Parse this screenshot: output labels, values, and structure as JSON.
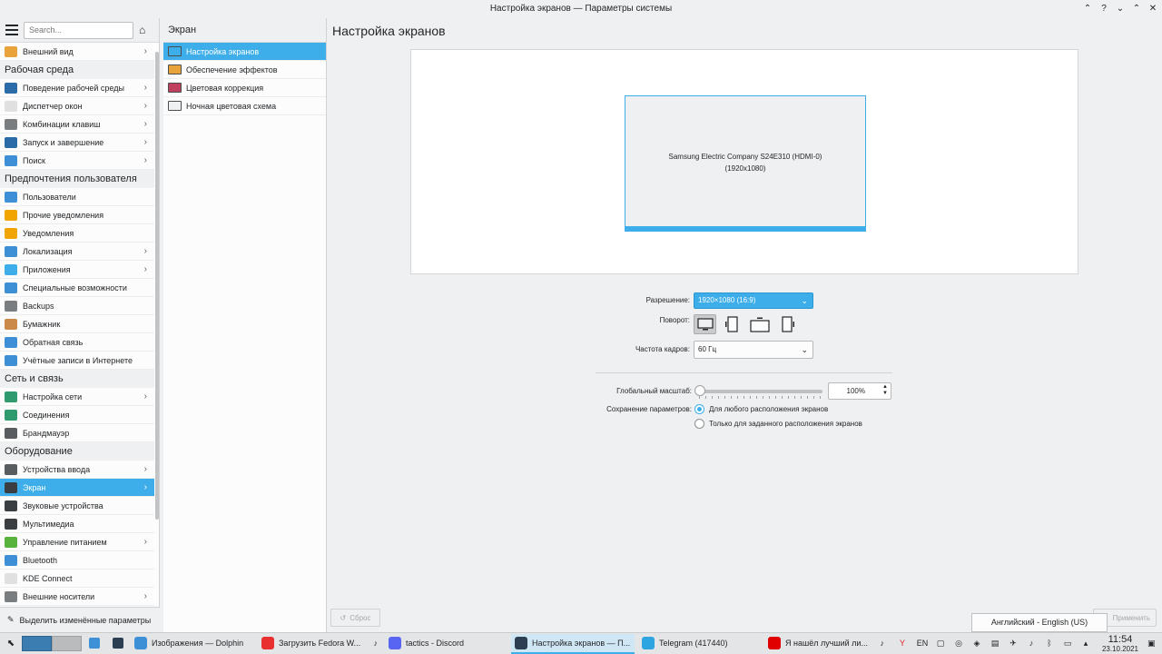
{
  "window": {
    "title": "Настройка экранов — Параметры системы",
    "buttons": [
      "⌃",
      "?",
      "⌄",
      "⌃",
      "✕"
    ]
  },
  "sidebar": {
    "search_placeholder": "Search...",
    "rows": [
      {
        "type": "item",
        "label": "Внешний вид",
        "chevron": true,
        "color": "#e8a33a"
      },
      {
        "type": "cat",
        "label": "Рабочая среда"
      },
      {
        "type": "item",
        "label": "Поведение рабочей среды",
        "chevron": true,
        "color": "#2b6ba8"
      },
      {
        "type": "item",
        "label": "Диспетчер окон",
        "chevron": true,
        "color": "#e0e0e0"
      },
      {
        "type": "item",
        "label": "Комбинации клавиш",
        "chevron": true,
        "color": "#7a7d80"
      },
      {
        "type": "item",
        "label": "Запуск и завершение",
        "chevron": true,
        "color": "#2b6ba8"
      },
      {
        "type": "item",
        "label": "Поиск",
        "chevron": true,
        "color": "#3d8fd6"
      },
      {
        "type": "cat",
        "label": "Предпочтения пользователя"
      },
      {
        "type": "item",
        "label": "Пользователи",
        "chevron": false,
        "color": "#3d8fd6"
      },
      {
        "type": "item",
        "label": "Прочие уведомления",
        "chevron": false,
        "color": "#f0a500"
      },
      {
        "type": "item",
        "label": "Уведомления",
        "chevron": false,
        "color": "#f0a500"
      },
      {
        "type": "item",
        "label": "Локализация",
        "chevron": true,
        "color": "#3d8fd6"
      },
      {
        "type": "item",
        "label": "Приложения",
        "chevron": true,
        "color": "#3daee9"
      },
      {
        "type": "item",
        "label": "Специальные возможности",
        "chevron": false,
        "color": "#3d8fd6"
      },
      {
        "type": "item",
        "label": "Backups",
        "chevron": false,
        "color": "#7a7d80"
      },
      {
        "type": "item",
        "label": "Бумажник",
        "chevron": false,
        "color": "#c98a4a"
      },
      {
        "type": "item",
        "label": "Обратная связь",
        "chevron": false,
        "color": "#3d8fd6"
      },
      {
        "type": "item",
        "label": "Учётные записи в Интернете",
        "chevron": false,
        "color": "#3d8fd6"
      },
      {
        "type": "cat",
        "label": "Сеть и связь"
      },
      {
        "type": "item",
        "label": "Настройка сети",
        "chevron": true,
        "color": "#2e9a6e"
      },
      {
        "type": "item",
        "label": "Соединения",
        "chevron": false,
        "color": "#2e9a6e"
      },
      {
        "type": "item",
        "label": "Брандмауэр",
        "chevron": false,
        "color": "#5a5d60"
      },
      {
        "type": "cat",
        "label": "Оборудование"
      },
      {
        "type": "item",
        "label": "Устройства ввода",
        "chevron": true,
        "color": "#5a5d60"
      },
      {
        "type": "item",
        "label": "Экран",
        "chevron": true,
        "color": "#3b3e41",
        "active": true
      },
      {
        "type": "item",
        "label": "Звуковые устройства",
        "chevron": false,
        "color": "#3b3e41"
      },
      {
        "type": "item",
        "label": "Мультимедиа",
        "chevron": false,
        "color": "#3b3e41"
      },
      {
        "type": "item",
        "label": "Управление питанием",
        "chevron": true,
        "color": "#58b33c"
      },
      {
        "type": "item",
        "label": "Bluetooth",
        "chevron": false,
        "color": "#3d8fd6"
      },
      {
        "type": "item",
        "label": "KDE Connect",
        "chevron": false,
        "color": "#e0e0e0"
      },
      {
        "type": "item",
        "label": "Внешние носители",
        "chevron": true,
        "color": "#7a7d80"
      }
    ],
    "bottom_label": "Выделить изменённые параметры"
  },
  "midcol": {
    "title": "Экран",
    "items": [
      {
        "label": "Настройка экранов",
        "active": true
      },
      {
        "label": "Обеспечение эффектов",
        "active": false
      },
      {
        "label": "Цветовая коррекция",
        "active": false
      },
      {
        "label": "Ночная цветовая схема",
        "active": false
      }
    ]
  },
  "main": {
    "title": "Настройка экранов",
    "monitor_name": "Samsung Electric Company S24E310 (HDMI-0)",
    "monitor_res": "(1920x1080)",
    "resolution_label": "Разрешение:",
    "resolution_value": "1920×1080 (16:9)",
    "rotation_label": "Поворот:",
    "frequency_label": "Частота кадров:",
    "frequency_value": "60 Гц",
    "scale_label": "Глобальный масштаб:",
    "scale_value": "100%",
    "save_label": "Сохранение параметров:",
    "save_option1": "Для любого расположения экранов",
    "save_option2": "Только для заданного расположения экранов",
    "reset_label": "Сброс",
    "apply_label": "Применить"
  },
  "tooltip": "Английский - English (US)",
  "taskbar": {
    "tasks": [
      {
        "label": "Изображения — Dolphin",
        "color": "#3d8fd6",
        "active": false,
        "vol": false
      },
      {
        "label": "Загрузить Fedora W...",
        "color": "#e83030",
        "active": false,
        "vol": true
      },
      {
        "label": "tactics - Discord",
        "color": "#5865f2",
        "active": false,
        "vol": false
      },
      {
        "label": "Настройка экранов — П...",
        "color": "#2b3e52",
        "active": true,
        "vol": false
      },
      {
        "label": "Telegram (417440)",
        "color": "#2ca5e0",
        "active": false,
        "vol": false
      },
      {
        "label": "Я нашёл лучший ли...",
        "color": "#e00000",
        "active": false,
        "vol": true
      }
    ],
    "lang": "EN",
    "time": "11:54",
    "date": "23.10.2021"
  }
}
